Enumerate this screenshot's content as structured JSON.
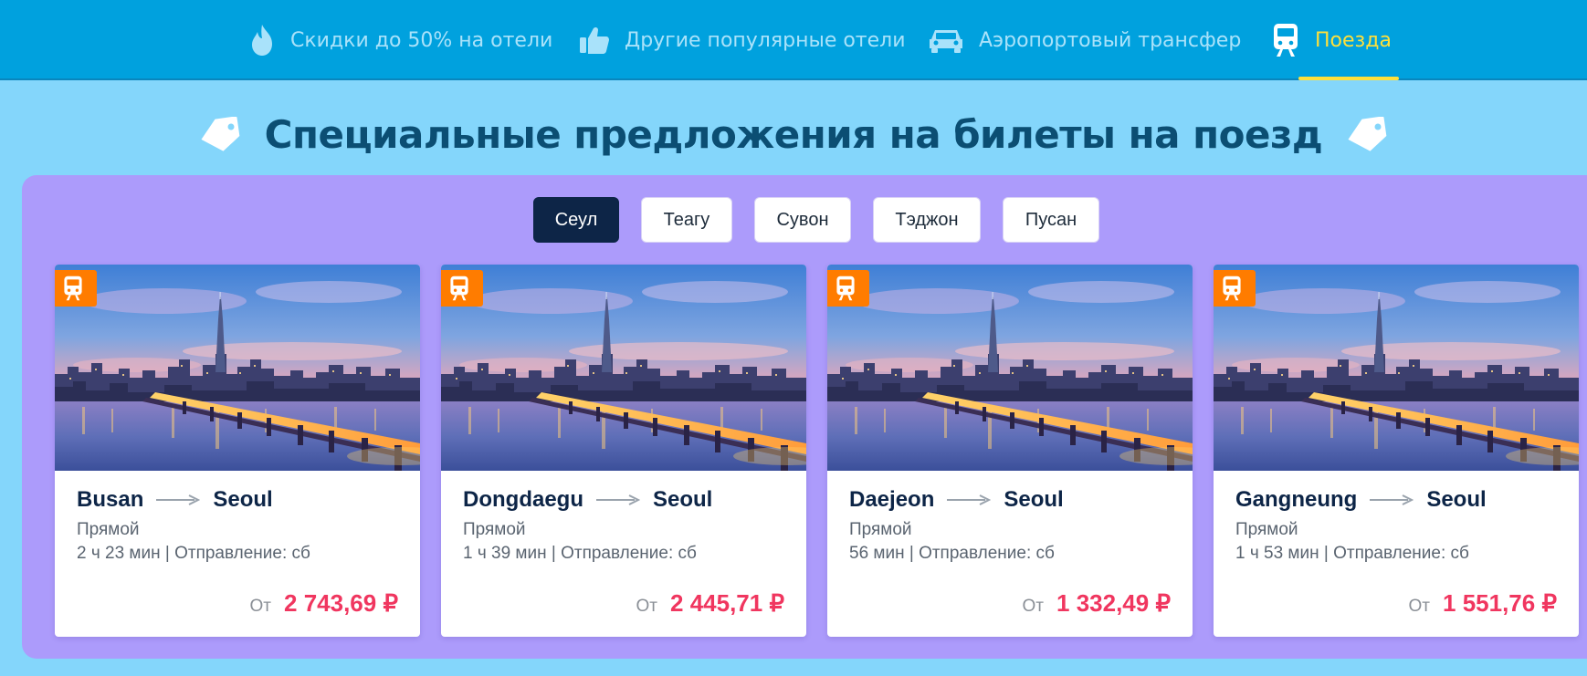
{
  "nav": {
    "items": [
      {
        "label": "Скидки до 50% на отели",
        "icon": "flame-icon"
      },
      {
        "label": "Другие популярные отели",
        "icon": "thumbs-up-icon"
      },
      {
        "label": "Аэропортовый трансфер",
        "icon": "car-icon"
      },
      {
        "label": "Поезда",
        "icon": "train-icon",
        "active": true
      }
    ]
  },
  "heading": {
    "title": "Специальные предложения на билеты на поезд",
    "icon": "price-tag-icon"
  },
  "tabs": [
    {
      "label": "Сеул",
      "active": true
    },
    {
      "label": "Теагу"
    },
    {
      "label": "Сувон"
    },
    {
      "label": "Тэджон"
    },
    {
      "label": "Пусан"
    }
  ],
  "cards": [
    {
      "from": "Busan",
      "to": "Seoul",
      "type": "Прямой",
      "details": "2 ч 23 мин | Отправление: сб",
      "price_prefix": "От",
      "price": "2 743,69 ₽"
    },
    {
      "from": "Dongdaegu",
      "to": "Seoul",
      "type": "Прямой",
      "details": "1 ч 39 мин | Отправление: сб",
      "price_prefix": "От",
      "price": "2 445,71 ₽"
    },
    {
      "from": "Daejeon",
      "to": "Seoul",
      "type": "Прямой",
      "details": "56 мин | Отправление: сб",
      "price_prefix": "От",
      "price": "1 332,49 ₽"
    },
    {
      "from": "Gangneung",
      "to": "Seoul",
      "type": "Прямой",
      "details": "1 ч 53 мин | Отправление: сб",
      "price_prefix": "От",
      "price": "1 551,76 ₽"
    }
  ],
  "colors": {
    "nav_bg": "#00a1de",
    "page_bg": "#84d6fb",
    "panel_bg": "#ac9bfb",
    "active_nav": "#ffe03a",
    "price": "#f0365f",
    "badge": "#ff7c00",
    "active_tab": "#0d2547"
  }
}
